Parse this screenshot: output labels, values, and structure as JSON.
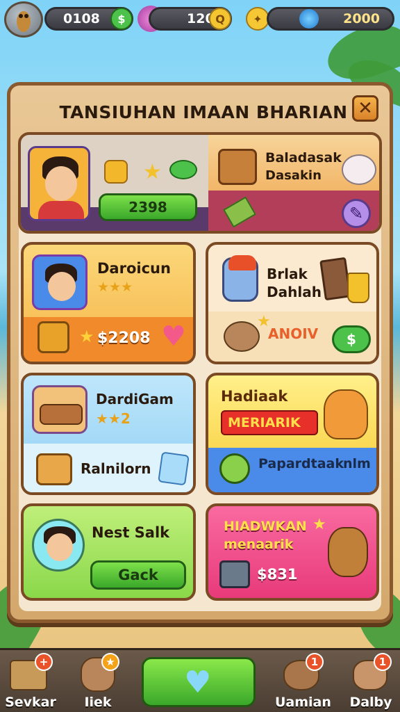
{
  "hud": {
    "resource1": "0108",
    "resource2": "120",
    "resource3": "2000"
  },
  "panel": {
    "title": "TANSIUHAN IMAAN BHARIAN",
    "close_symbol": "✕"
  },
  "cards": {
    "profile": {
      "button_value": "2398",
      "reward_title_line1": "Baladasak",
      "reward_title_line2": "Dasakin"
    },
    "c1": {
      "title": "Daroicun",
      "stars": "★★★",
      "price": "$2208"
    },
    "c2": {
      "title_line1": "Brlak",
      "title_line2": "Dahlah",
      "label": "ANOIV"
    },
    "c3": {
      "title": "DardiGam",
      "stars": "★★2",
      "item_label": "Ralnilorn"
    },
    "c4": {
      "title": "Hadiaak",
      "banner": "MERIARIK",
      "item_label": "Papardtaak",
      "suffix": "nlm"
    },
    "c5": {
      "title": "Nest Salk",
      "button": "Gack"
    },
    "c6": {
      "title_line1": "HIADWKAN",
      "title_line2": "menaarik",
      "price": "$831"
    }
  },
  "bottom_nav": [
    {
      "label": "Sevkar",
      "badge": "+",
      "icon": "box-icon"
    },
    {
      "label": "Iiek",
      "badge": "★",
      "icon": "dog-icon"
    },
    {
      "label": "",
      "icon": "heart-icon"
    },
    {
      "label": "Uamian",
      "badge": "1",
      "icon": "bear-icon"
    },
    {
      "label": "Dalby",
      "badge": "1",
      "icon": "dog-face-icon"
    }
  ]
}
